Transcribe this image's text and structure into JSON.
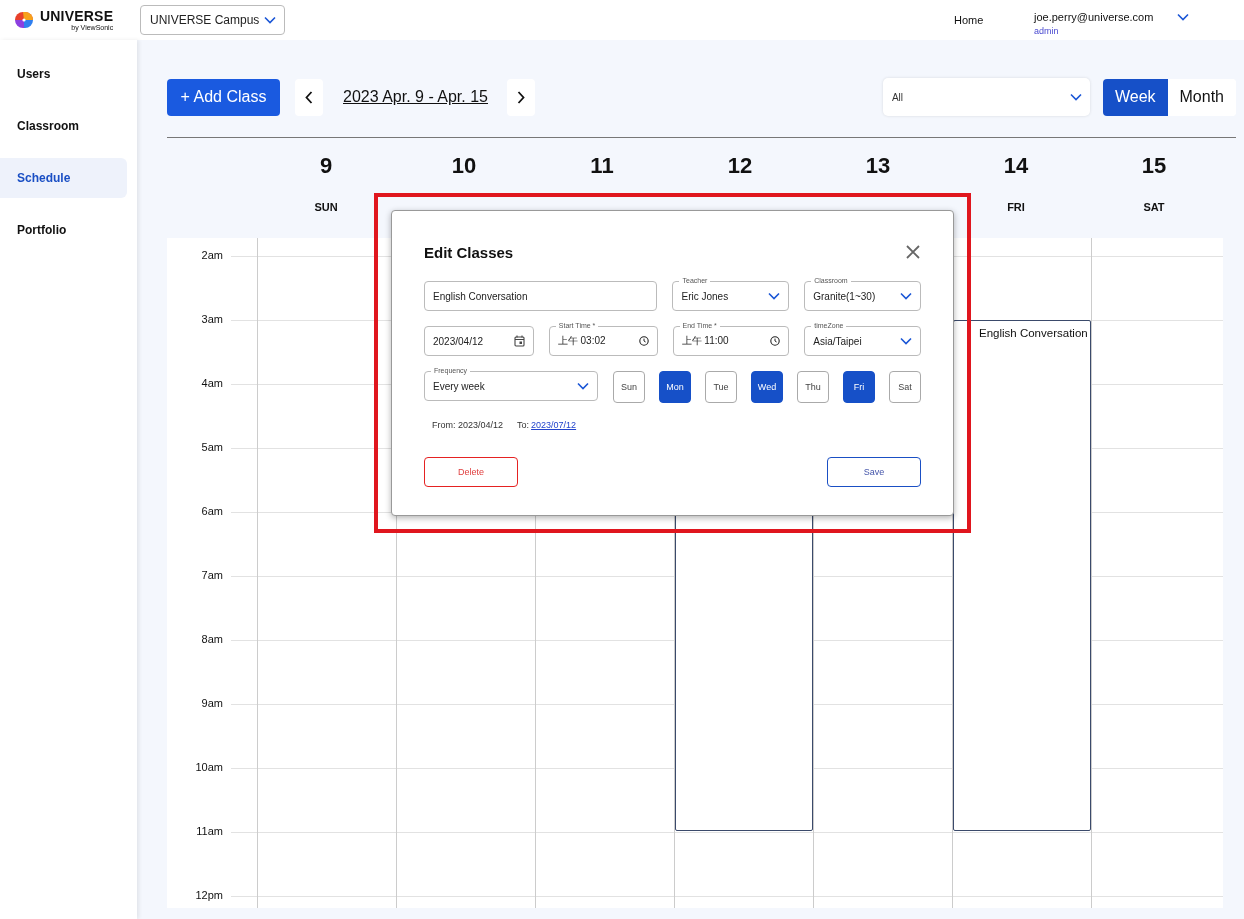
{
  "header": {
    "logo": {
      "name": "UNIVERSE",
      "tagline": "by ViewSonic"
    },
    "campus": "UNIVERSE Campus",
    "home": "Home",
    "user": {
      "email": "joe.perry@universe.com",
      "role": "admin"
    }
  },
  "sidebar": {
    "items": [
      {
        "label": "Users",
        "selected": false
      },
      {
        "label": "Classroom",
        "selected": false
      },
      {
        "label": "Schedule",
        "selected": true
      },
      {
        "label": "Portfolio",
        "selected": false
      }
    ]
  },
  "toolbar": {
    "add_button": "+ Add Class",
    "range": "2023 Apr. 9 - Apr. 15",
    "filter": "All",
    "views": [
      {
        "label": "Week",
        "selected": true
      },
      {
        "label": "Month",
        "selected": false
      }
    ]
  },
  "calendar": {
    "days": [
      {
        "date": "9",
        "name": "SUN"
      },
      {
        "date": "10"
      },
      {
        "date": "11"
      },
      {
        "date": "12",
        "event": true
      },
      {
        "date": "13"
      },
      {
        "date": "14",
        "name": "FRI",
        "event": {
          "title": "English Conversation"
        }
      },
      {
        "date": "15",
        "name": "SAT"
      }
    ],
    "hours": [
      "2am",
      "3am",
      "4am",
      "5am",
      "6am",
      "7am",
      "8am",
      "9am",
      "10am",
      "11am",
      "12pm"
    ]
  },
  "dialog": {
    "title": "Edit Classes",
    "name": "English Conversation",
    "teacher": {
      "label": "Teacher",
      "value": "Eric Jones"
    },
    "classroom": {
      "label": "Classroom",
      "value": "Granite(1~30)"
    },
    "date": "2023/04/12",
    "start": {
      "label": "Start Time *",
      "value": "上午 03:02"
    },
    "end": {
      "label": "End Time *",
      "value": "上午 11:00"
    },
    "timezone": {
      "label": "timeZone",
      "value": "Asia/Taipei"
    },
    "frequency": {
      "label": "Frequency",
      "value": "Every week"
    },
    "weekdays": [
      {
        "label": "Sun",
        "selected": false
      },
      {
        "label": "Mon",
        "selected": true
      },
      {
        "label": "Tue",
        "selected": false
      },
      {
        "label": "Wed",
        "selected": true
      },
      {
        "label": "Thu",
        "selected": false
      },
      {
        "label": "Fri",
        "selected": true
      },
      {
        "label": "Sat",
        "selected": false
      }
    ],
    "from": "From: 2023/04/12",
    "to_label": "To:",
    "to_date": "2023/07/12",
    "delete": "Delete",
    "save": "Save"
  }
}
